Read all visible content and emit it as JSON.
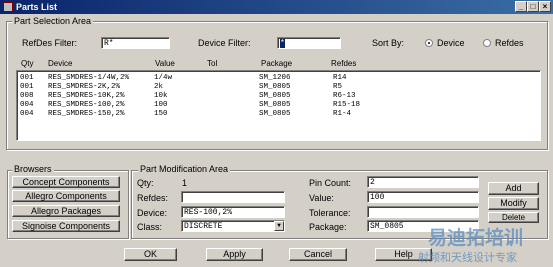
{
  "window": {
    "title": "Parts List"
  },
  "selection": {
    "group_title": "Part Selection Area",
    "refdes_label": "RefDes Filter:",
    "refdes_value": "R*",
    "device_label": "Device Filter:",
    "device_value": "*",
    "sortby_label": "Sort By:",
    "sort_device": "Device",
    "sort_refdes": "Refdes",
    "headers": {
      "qty": "Qty",
      "device": "Device",
      "value": "Value",
      "tol": "Tol",
      "package": "Package",
      "refdes": "Refdes"
    },
    "rows": [
      {
        "qty": "001",
        "device": "RES_SMDRES-1/4W,2%",
        "value": "1/4w",
        "tol": "",
        "package": "SM_1206",
        "refdes": "R14"
      },
      {
        "qty": "001",
        "device": "RES_SMDRES-2K,2%",
        "value": "2k",
        "tol": "",
        "package": "SM_0805",
        "refdes": "R5"
      },
      {
        "qty": "008",
        "device": "RES_SMDRES-10K,2%",
        "value": "10k",
        "tol": "",
        "package": "SM_0805",
        "refdes": "R6-13"
      },
      {
        "qty": "004",
        "device": "RES_SMDRES-100,2%",
        "value": "100",
        "tol": "",
        "package": "SM_0805",
        "refdes": "R15-18"
      },
      {
        "qty": "004",
        "device": "RES_SMDRES-150,2%",
        "value": "150",
        "tol": "",
        "package": "SM_0805",
        "refdes": "R1-4"
      }
    ]
  },
  "browsers": {
    "group_title": "Browsers",
    "concept": "Concept Components",
    "allegro": "Allegro Components",
    "packages": "Allegro Packages",
    "signoise": "Signoise Components"
  },
  "modification": {
    "group_title": "Part Modification Area",
    "qty_label": "Qty:",
    "qty_value": "1",
    "refdes_label": "Refdes:",
    "refdes_value": "",
    "device_label": "Device:",
    "device_value": "RES-100,2%",
    "class_label": "Class:",
    "class_value": "DISCRETE",
    "pincount_label": "Pin Count:",
    "pincount_value": "2",
    "value_label": "Value:",
    "value_value": "100",
    "tolerance_label": "Tolerance:",
    "tolerance_value": "",
    "package_label": "Package:",
    "package_value": "SM_0805"
  },
  "side_buttons": {
    "add": "Add",
    "modify": "Modify",
    "delete": "Delete"
  },
  "footer": {
    "ok": "OK",
    "apply": "Apply",
    "cancel": "Cancel",
    "help": "Help"
  },
  "watermark": {
    "line1": "易迪拓培训",
    "line2": "射频和天线设计专家"
  }
}
